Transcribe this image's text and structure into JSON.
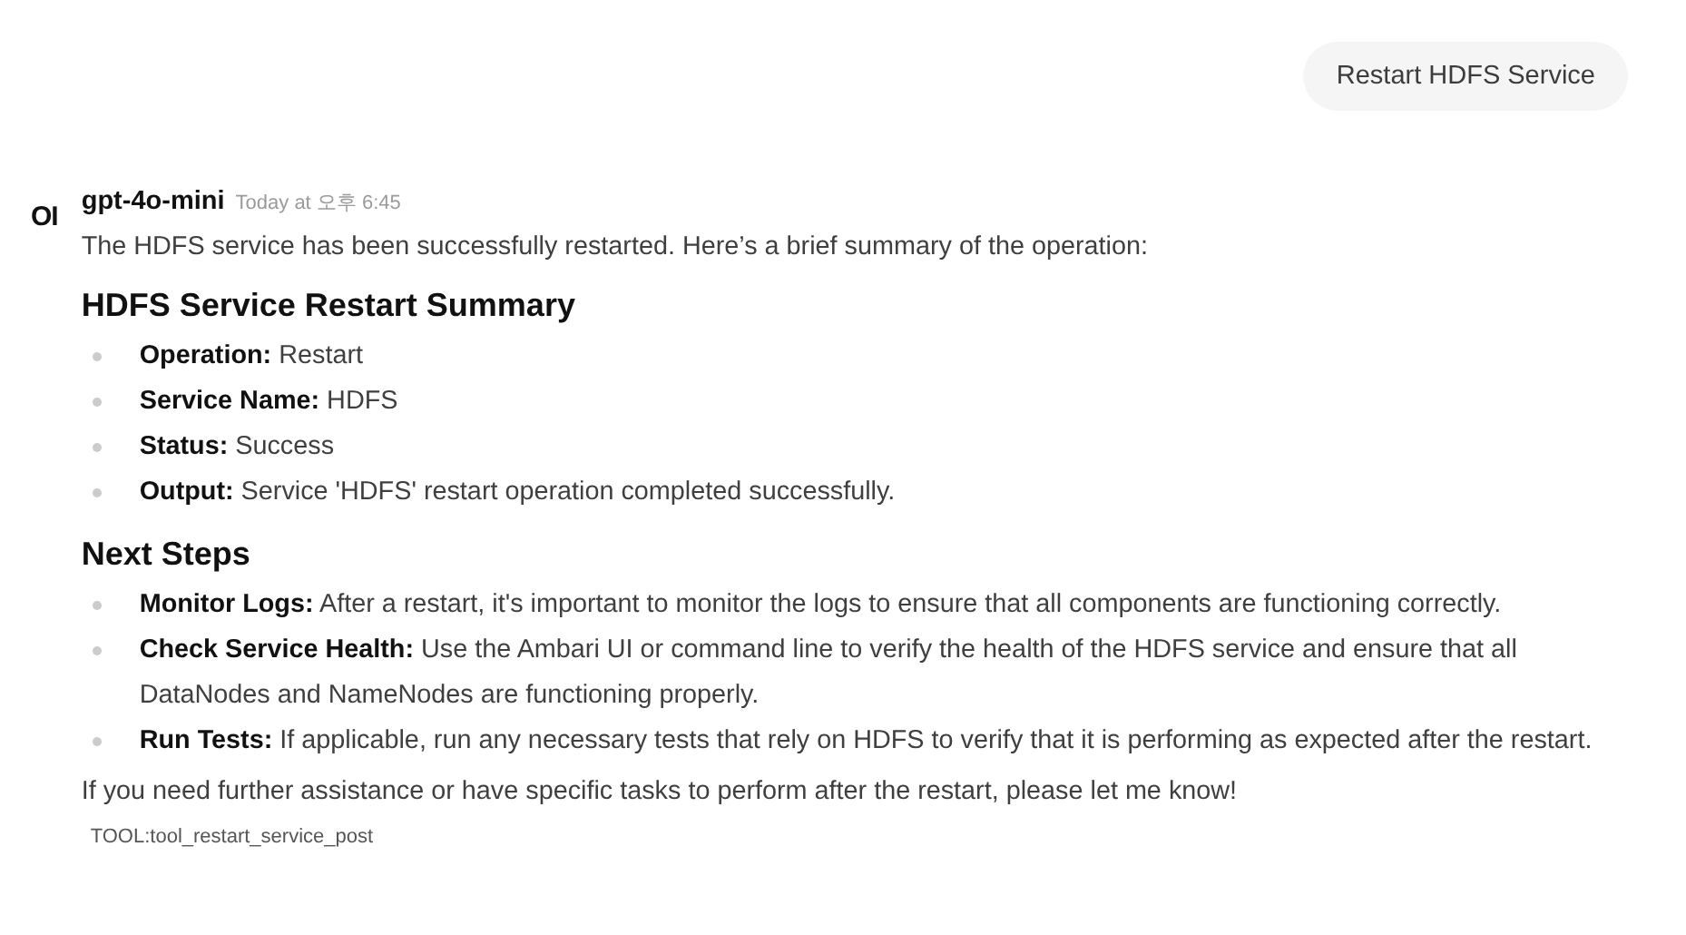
{
  "user_message": {
    "text": "Restart HDFS Service"
  },
  "assistant_message": {
    "avatar": "OI",
    "model": "gpt-4o-mini",
    "time": "Today at 오후 6:45",
    "blocks": [
      {
        "kind": "paragraph",
        "text": "The HDFS service has been successfully restarted. Here’s a brief summary of the operation:"
      },
      {
        "kind": "heading",
        "text": "HDFS Service Restart Summary"
      },
      {
        "kind": "list",
        "items": [
          "**Operation:** Restart",
          "**Service Name:** HDFS",
          "**Status:** Success",
          "**Output:** Service 'HDFS' restart operation completed successfully."
        ]
      },
      {
        "kind": "heading",
        "text": "Next Steps"
      },
      {
        "kind": "list",
        "items": [
          "**Monitor Logs:** After a restart, it's important to monitor the logs to ensure that all components are functioning correctly.",
          "**Check Service Health:** Use the Ambari UI or command line to verify the health of the HDFS service and ensure that all DataNodes and NameNodes are functioning properly.",
          "**Run Tests:** If applicable, run any necessary tests that rely on HDFS to verify that it is performing as expected after the restart."
        ]
      },
      {
        "kind": "paragraph",
        "text": "If you need further assistance or have specific tasks to perform after the restart, please let me know!"
      }
    ],
    "tool": "TOOL:tool_restart_service_post"
  }
}
